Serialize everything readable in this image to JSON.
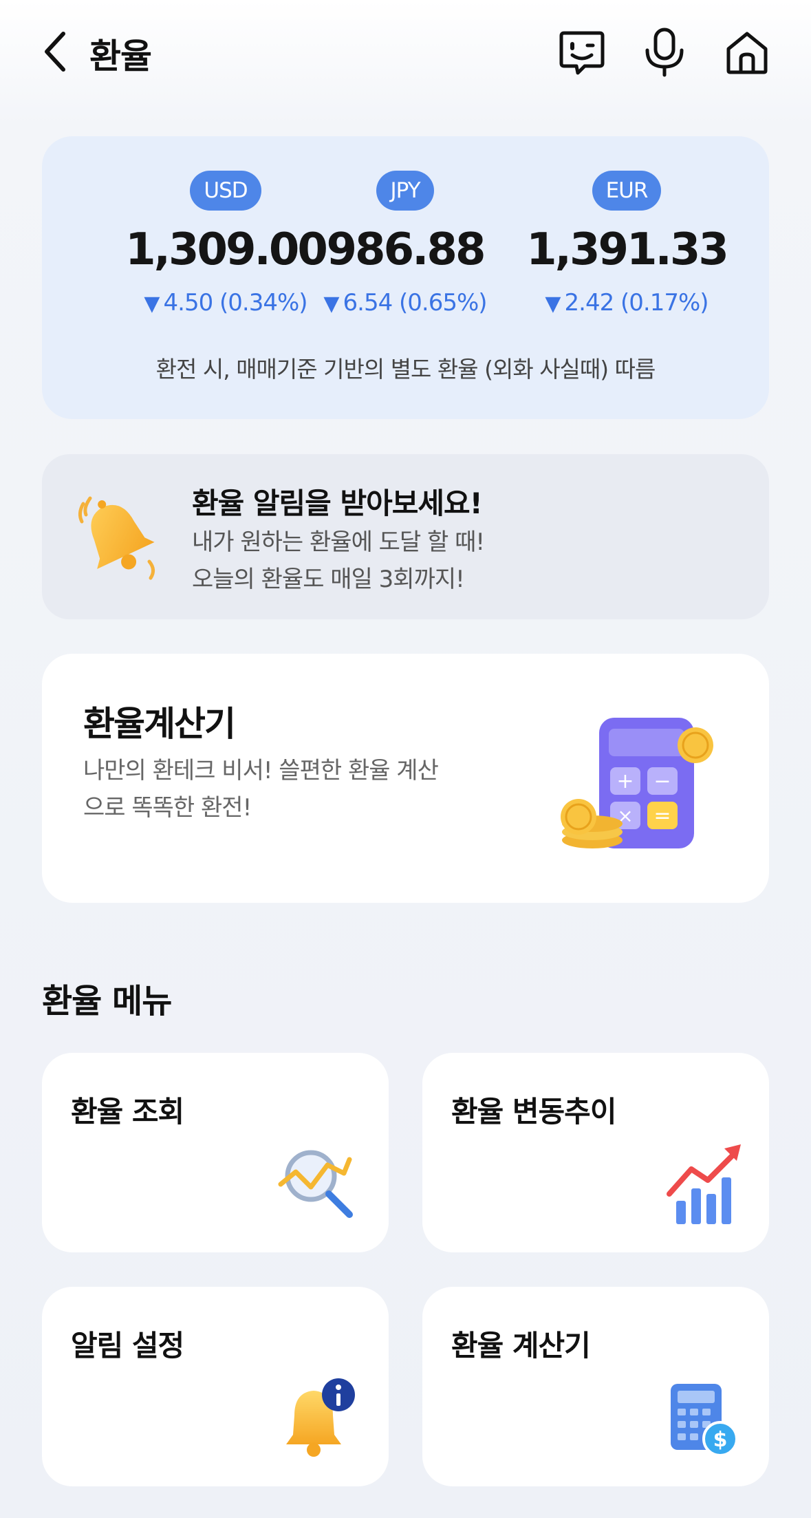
{
  "header": {
    "title": "환율",
    "icons": [
      "chevron-left-icon",
      "chat-bot-icon",
      "microphone-icon",
      "home-icon"
    ]
  },
  "rates": [
    {
      "code": "USD",
      "value": "1,309.00",
      "change": "4.50 (0.34%)",
      "direction": "down"
    },
    {
      "code": "JPY",
      "value": "986.88",
      "change": "6.54 (0.65%)",
      "direction": "down"
    },
    {
      "code": "EUR",
      "value": "1,391.33",
      "change": "2.42 (0.17%)",
      "direction": "down"
    }
  ],
  "rate_note": "환전 시, 매매기준 기반의 별도 환율 (외화 사실때) 따름",
  "alert_banner": {
    "title": "환율 알림을 받아보세요!",
    "line1": "내가 원하는 환율에 도달 할 때!",
    "line2": "오늘의 환율도 매일 3회까지!"
  },
  "calculator_card": {
    "title": "환율계산기",
    "desc_line1": "나만의 환테크 비서! 쓸편한 환율 계산",
    "desc_line2": "으로 똑똑한 환전!"
  },
  "menu": {
    "title": "환율 메뉴",
    "items": [
      {
        "label": "환율 조회",
        "icon": "magnifier-chart-icon"
      },
      {
        "label": "환율 변동추이",
        "icon": "trend-chart-icon"
      },
      {
        "label": "알림 설정",
        "icon": "bell-info-icon"
      },
      {
        "label": "환율 계산기",
        "icon": "calculator-dollar-icon"
      }
    ]
  },
  "colors": {
    "accent": "#4e86e8",
    "down": "#3a73e4",
    "rate_card_bg": "#e6eefb",
    "banner_bg": "#e8ebf2"
  }
}
